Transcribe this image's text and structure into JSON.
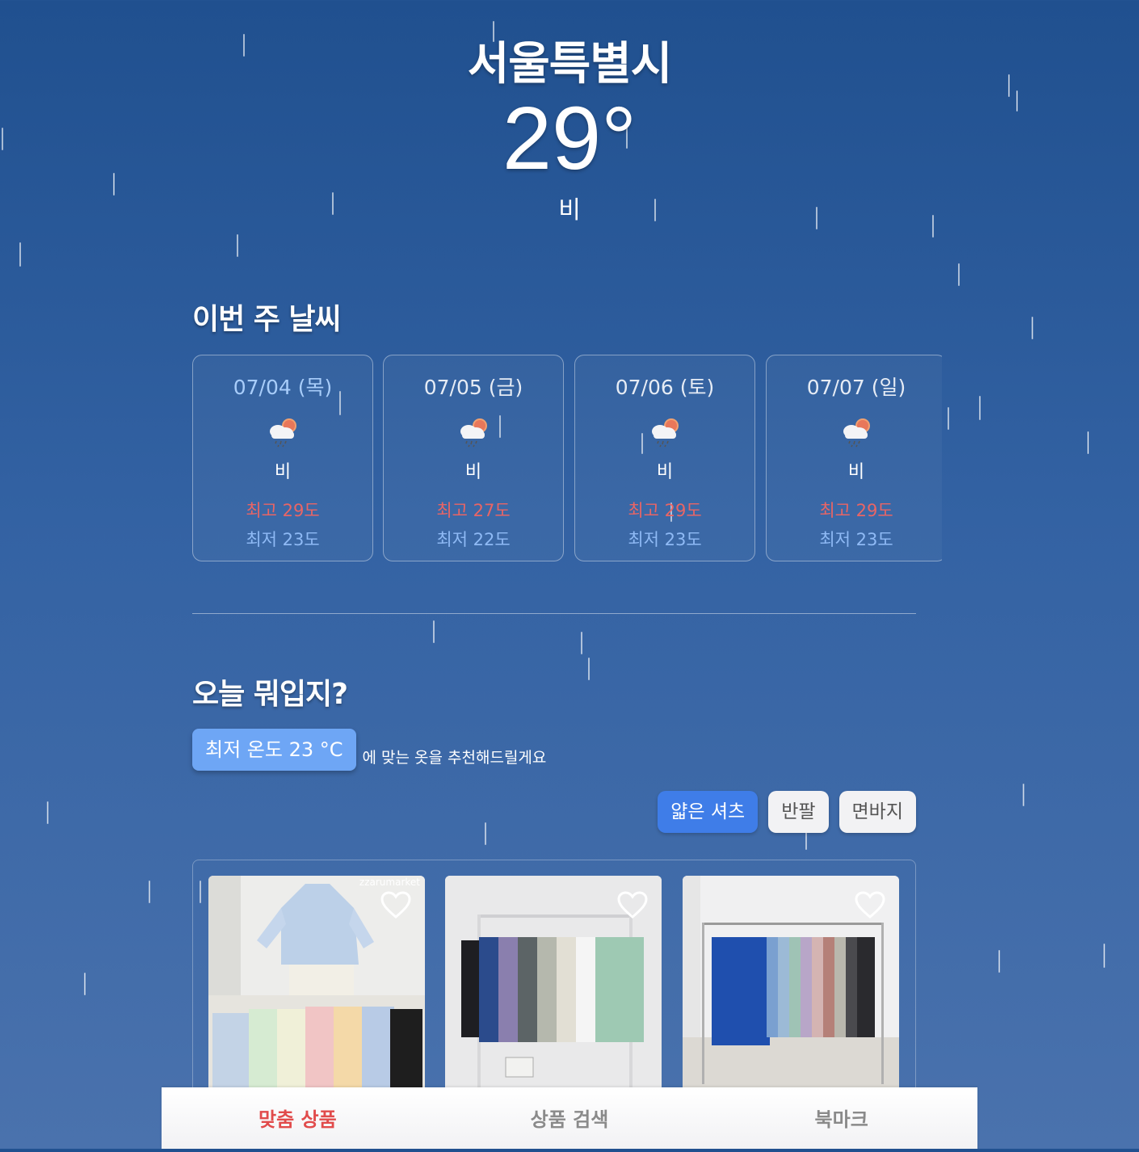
{
  "location": {
    "city": "서울특별시",
    "temperature": "29°",
    "condition": "비"
  },
  "weekly": {
    "title": "이번 주 날씨",
    "days": [
      {
        "date": "07/04 (목)",
        "icon": "rain-cloud-sun-icon",
        "condition": "비",
        "max": "최고 29도",
        "min": "최저 23도"
      },
      {
        "date": "07/05 (금)",
        "icon": "rain-cloud-sun-icon",
        "condition": "비",
        "max": "최고 27도",
        "min": "최저 22도"
      },
      {
        "date": "07/06 (토)",
        "icon": "rain-cloud-sun-icon",
        "condition": "비",
        "max": "최고 29도",
        "min": "최저 23도"
      },
      {
        "date": "07/07 (일)",
        "icon": "rain-cloud-sun-icon",
        "condition": "비",
        "max": "최고 29도",
        "min": "최저 23도"
      }
    ]
  },
  "recommend": {
    "title": "오늘 뭐입지?",
    "badge": "최저 온도 23 °C",
    "text": "에 맞는 옷을 추천해드릴게요",
    "chips": [
      "얇은 셔츠",
      "반팔",
      "면바지"
    ],
    "active_chip": "얇은 셔츠",
    "products": [
      {
        "watermark": "zzarumarket",
        "bookmark_icon": "heart-outline-icon"
      },
      {
        "watermark": "",
        "bookmark_icon": "heart-outline-icon"
      },
      {
        "watermark": "",
        "bookmark_icon": "heart-outline-icon"
      }
    ]
  },
  "nav": {
    "items": [
      "맞춤 상품",
      "상품 검색",
      "북마크"
    ],
    "active": "맞춤 상품"
  },
  "colors": {
    "max_temp": "#e96565",
    "min_temp": "#8fbaf5",
    "accent": "#3f7de8",
    "nav_active": "#e14b4b"
  }
}
